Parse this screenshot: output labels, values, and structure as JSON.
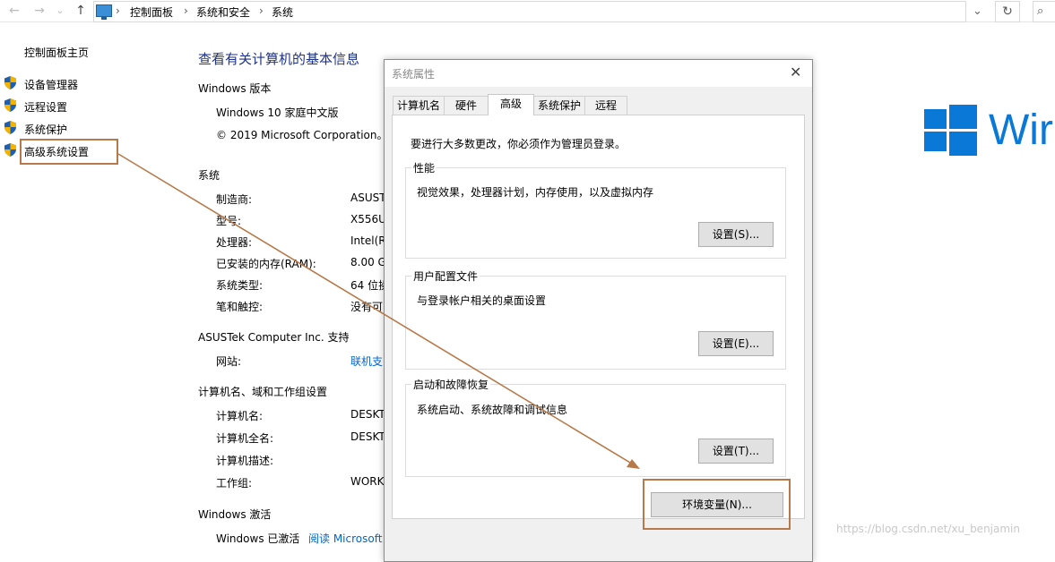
{
  "address_bar": {
    "back_glyph": "←",
    "forward_glyph": "→",
    "dropdown_glyph": "⌄",
    "up_glyph": "↑",
    "crumbs": [
      "控制面板",
      "系统和安全",
      "系统"
    ],
    "separator": "›",
    "refresh_glyph": "↻",
    "search_glyph": "⌕"
  },
  "left_pane": {
    "home": "控制面板主页",
    "items": [
      {
        "label": "设备管理器",
        "icon": "shield-icon"
      },
      {
        "label": "远程设置",
        "icon": "shield-icon"
      },
      {
        "label": "系统保护",
        "icon": "shield-icon"
      },
      {
        "label": "高级系统设置",
        "icon": "shield-icon"
      }
    ]
  },
  "main": {
    "title": "查看有关计算机的基本信息",
    "edition_header": "Windows 版本",
    "edition": "Windows 10 家庭中文版",
    "copyright": "© 2019 Microsoft Corporation。",
    "system_header": "系统",
    "system_rows": [
      {
        "label": "制造商:",
        "value": "ASUST"
      },
      {
        "label": "型号:",
        "value": "X556U"
      },
      {
        "label": "处理器:",
        "value": "Intel(R"
      },
      {
        "label": "已安装的内存(RAM):",
        "value": "8.00 G"
      },
      {
        "label": "系统类型:",
        "value": "64 位操"
      },
      {
        "label": "笔和触控:",
        "value": "没有可"
      }
    ],
    "support_header": "ASUSTek Computer Inc. 支持",
    "support_rows": [
      {
        "label": "网站:",
        "value": "联机支"
      }
    ],
    "computer_header": "计算机名、域和工作组设置",
    "computer_rows": [
      {
        "label": "计算机名:",
        "value": "DESKT"
      },
      {
        "label": "计算机全名:",
        "value": "DESKT"
      },
      {
        "label": "计算机描述:",
        "value": ""
      },
      {
        "label": "工作组:",
        "value": "WORK"
      }
    ],
    "activation_header": "Windows 激活",
    "activation_status": "Windows 已激活",
    "activation_link": "阅读 Microsoft",
    "windows_logo_text": "Wir"
  },
  "dialog": {
    "title": "系统属性",
    "close_glyph": "✕",
    "tabs": [
      "计算机名",
      "硬件",
      "高级",
      "系统保护",
      "远程"
    ],
    "active_tab": "高级",
    "notice": "要进行大多数更改，你必须作为管理员登录。",
    "groups": [
      {
        "label": "性能",
        "desc": "视觉效果，处理器计划，内存使用，以及虚拟内存",
        "button": "设置(S)..."
      },
      {
        "label": "用户配置文件",
        "desc": "与登录帐户相关的桌面设置",
        "button": "设置(E)..."
      },
      {
        "label": "启动和故障恢复",
        "desc": "系统启动、系统故障和调试信息",
        "button": "设置(T)..."
      }
    ],
    "env_button": "环境变量(N)..."
  },
  "watermark": "https://blog.csdn.net/xu_benjamin",
  "colors": {
    "accent": "#0a78d7",
    "heading": "#1e3287",
    "link": "#0066cc",
    "annotation": "#b77949"
  }
}
